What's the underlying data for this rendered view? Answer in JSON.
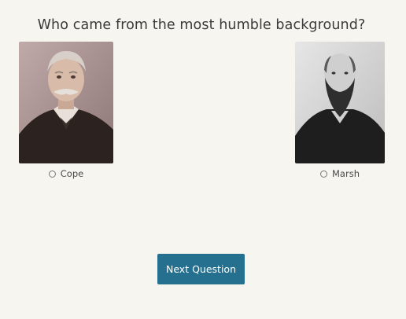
{
  "quiz": {
    "question": "Who came from the most humble background?",
    "options": [
      {
        "label": "Cope",
        "selected": false
      },
      {
        "label": "Marsh",
        "selected": false
      }
    ],
    "next_label": "Next Question"
  },
  "colors": {
    "background": "#f7f5ef",
    "button": "#25708f",
    "button_text": "#ffffff"
  }
}
